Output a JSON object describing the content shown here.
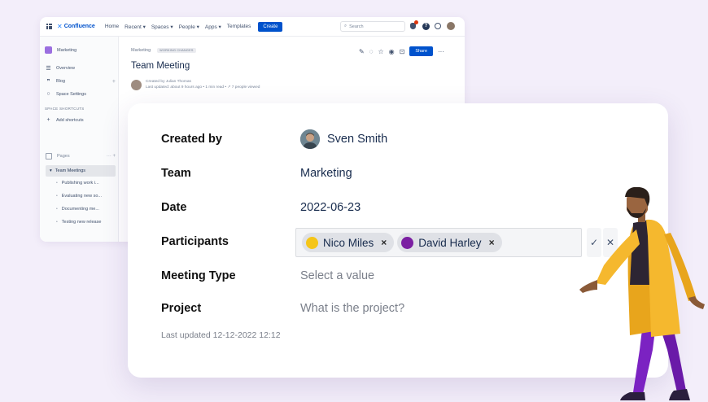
{
  "confluence": {
    "brand": "Confluence",
    "nav": [
      "Home",
      "Recent ▾",
      "Spaces ▾",
      "People ▾",
      "Apps ▾",
      "Templates"
    ],
    "create": "Create",
    "search_placeholder": "Search",
    "notification_count": "3",
    "help_glyph": "?",
    "sidebar": {
      "space_name": "Marketing",
      "items": [
        {
          "label": "Overview",
          "icon": "overview-icon",
          "glyph": "☰"
        },
        {
          "label": "Blog",
          "icon": "quote-icon",
          "glyph": "❞"
        },
        {
          "label": "Space Settings",
          "icon": "settings-icon",
          "glyph": "○"
        }
      ],
      "shortcuts_heading": "SPACE SHORTCUTS",
      "add_shortcut": "Add shortcuts",
      "pages_label": "Pages",
      "tree_active": "Team Meetings",
      "tree_items": [
        "Publishing work i...",
        "Evaluating new so...",
        "Documenting me...",
        "Testing new release"
      ]
    },
    "page": {
      "breadcrumb": "Marketing",
      "badge": "WORKING CHANGES",
      "title": "Team Meeting",
      "created_by": "Created by Julian Thomas",
      "meta": "Last updated: about 9 hours ago • 1 min read • ↗ 7 people viewed",
      "share": "Share"
    }
  },
  "card": {
    "created_by": {
      "label": "Created by",
      "name": "Sven Smith"
    },
    "team": {
      "label": "Team",
      "value": "Marketing"
    },
    "date": {
      "label": "Date",
      "value": "2022-06-23"
    },
    "participants": {
      "label": "Participants",
      "people": [
        {
          "name": "Nico Miles",
          "color": "#f5c518"
        },
        {
          "name": "David Harley",
          "color": "#7b1fa2"
        }
      ],
      "remove_glyph": "×",
      "confirm_glyph": "✓",
      "cancel_glyph": "✕"
    },
    "meeting_type": {
      "label": "Meeting Type",
      "placeholder": "Select a value"
    },
    "project": {
      "label": "Project",
      "placeholder": "What is the project?"
    },
    "last_updated": "Last updated 12-12-2022 12:12"
  },
  "colors": {
    "accent": "#0052cc",
    "background": "#f3eefa",
    "coat": "#f5b82e",
    "pants": "#7b22c2"
  }
}
